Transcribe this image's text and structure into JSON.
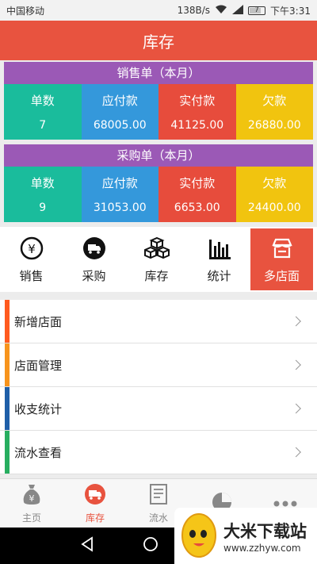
{
  "status": {
    "carrier": "中国移动",
    "speed": "138B/s",
    "battery": "7",
    "time": "下午3:31"
  },
  "title": "库存",
  "sales": {
    "header": "销售单（本月）",
    "cols": [
      {
        "label": "单数",
        "value": "7"
      },
      {
        "label": "应付款",
        "value": "68005.00"
      },
      {
        "label": "实付款",
        "value": "41125.00"
      },
      {
        "label": "欠款",
        "value": "26880.00"
      }
    ]
  },
  "purchase": {
    "header": "采购单（本月）",
    "cols": [
      {
        "label": "单数",
        "value": "9"
      },
      {
        "label": "应付款",
        "value": "31053.00"
      },
      {
        "label": "实付款",
        "value": "6653.00"
      },
      {
        "label": "欠款",
        "value": "24400.00"
      }
    ]
  },
  "nav": [
    {
      "label": "销售",
      "icon": "yen-circle-icon"
    },
    {
      "label": "采购",
      "icon": "truck-icon"
    },
    {
      "label": "库存",
      "icon": "boxes-icon"
    },
    {
      "label": "统计",
      "icon": "bar-chart-icon"
    },
    {
      "label": "多店面",
      "icon": "store-icon"
    }
  ],
  "menu": [
    {
      "label": "新增店面",
      "color": "#ff5a1f"
    },
    {
      "label": "店面管理",
      "color": "#f7941d"
    },
    {
      "label": "收支统计",
      "color": "#1f5fa8"
    },
    {
      "label": "流水查看",
      "color": "#27ae60"
    }
  ],
  "tabs": [
    {
      "label": "主页"
    },
    {
      "label": "库存"
    },
    {
      "label": "流水"
    }
  ],
  "colors": {
    "accent": "#e8533f",
    "purple": "#9b59b6",
    "teal": "#1abc9c",
    "blue": "#3498db",
    "red": "#e74c3c",
    "yellow": "#f1c40f"
  },
  "watermark": {
    "title": "大米下载站",
    "url": "www.zzhyw.com"
  }
}
